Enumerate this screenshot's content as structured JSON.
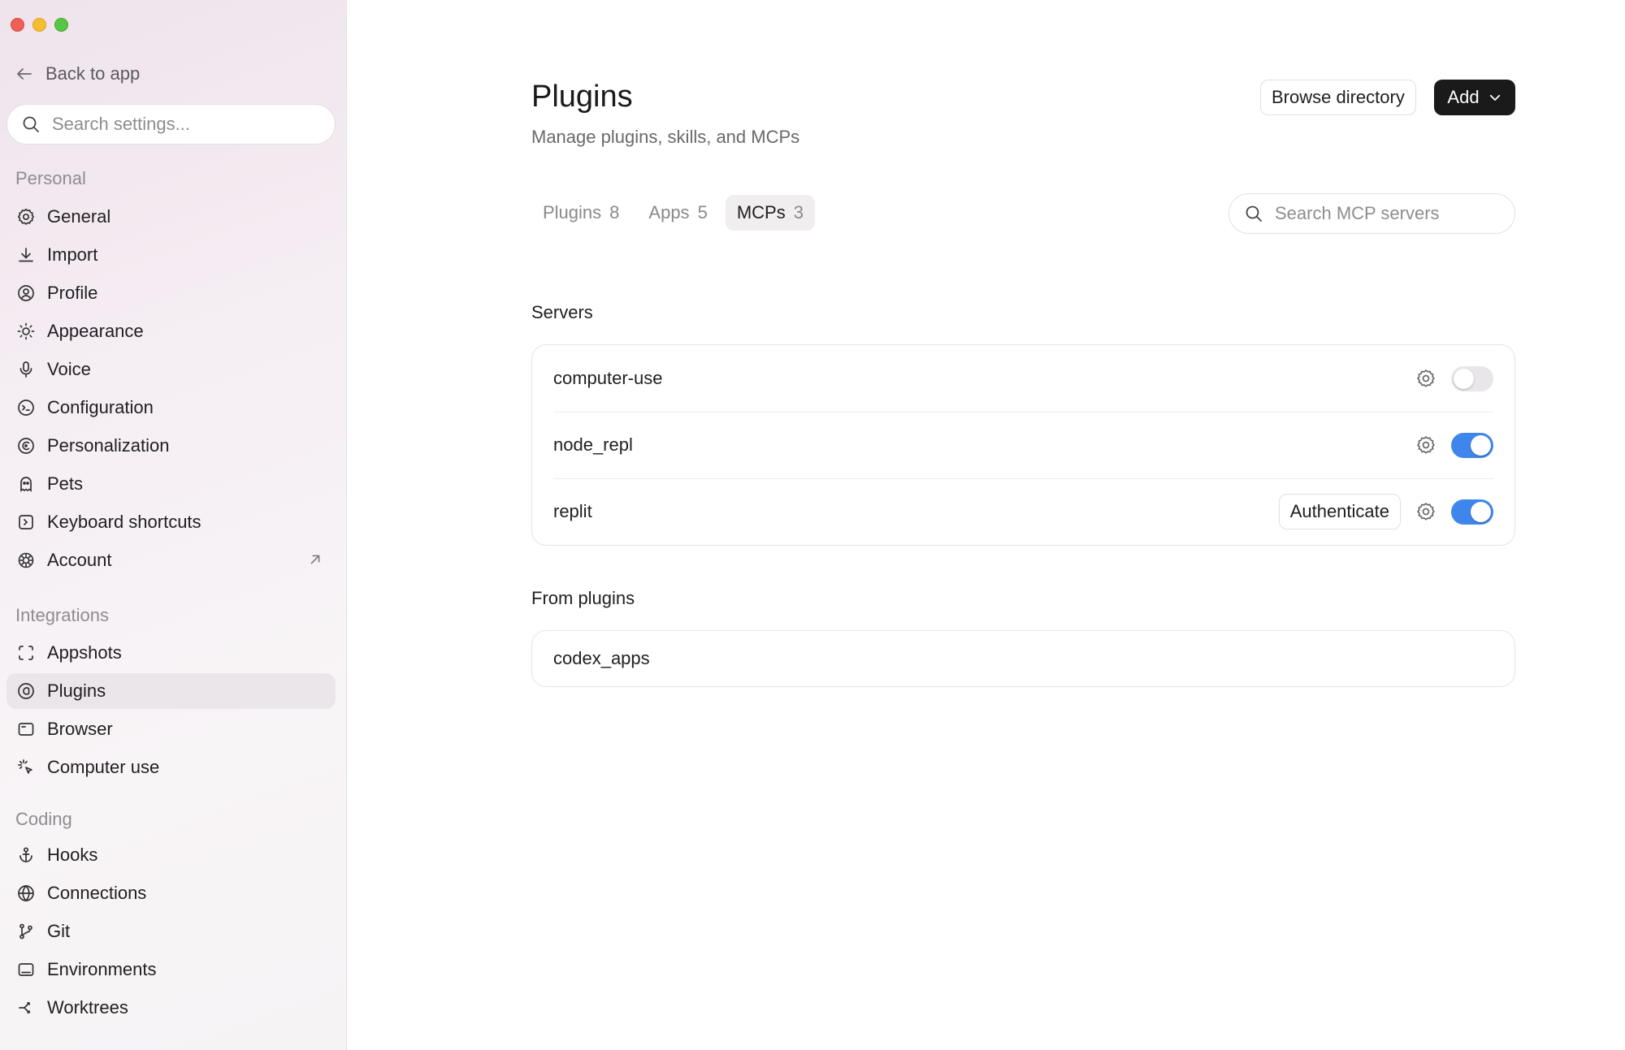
{
  "sidebar": {
    "back_label": "Back to app",
    "search_placeholder": "Search settings...",
    "sections": {
      "personal": "Personal",
      "integrations": "Integrations",
      "coding": "Coding"
    },
    "items": {
      "general": "General",
      "import": "Import",
      "profile": "Profile",
      "appearance": "Appearance",
      "voice": "Voice",
      "configuration": "Configuration",
      "personalization": "Personalization",
      "pets": "Pets",
      "keyboard_shortcuts": "Keyboard shortcuts",
      "account": "Account",
      "appshots": "Appshots",
      "plugins": "Plugins",
      "browser": "Browser",
      "computer_use": "Computer use",
      "hooks": "Hooks",
      "connections": "Connections",
      "git": "Git",
      "environments": "Environments",
      "worktrees": "Worktrees"
    },
    "active_item": "plugins"
  },
  "header": {
    "title": "Plugins",
    "subtitle": "Manage plugins, skills, and MCPs",
    "browse_label": "Browse directory",
    "add_label": "Add"
  },
  "tabs": [
    {
      "label": "Plugins",
      "count": "8",
      "active": false
    },
    {
      "label": "Apps",
      "count": "5",
      "active": false
    },
    {
      "label": "MCPs",
      "count": "3",
      "active": true
    }
  ],
  "search": {
    "placeholder": "Search MCP servers"
  },
  "servers": {
    "title": "Servers",
    "rows": [
      {
        "name": "computer-use",
        "enabled": false
      },
      {
        "name": "node_repl",
        "enabled": true
      },
      {
        "name": "replit",
        "enabled": true,
        "action_label": "Authenticate"
      }
    ]
  },
  "from_plugins": {
    "title": "From plugins",
    "rows": [
      {
        "name": "codex_apps"
      }
    ]
  },
  "colors": {
    "accent": "#3f86ec",
    "primary_button": "#1a1a1a",
    "active_nav": "#ebe6ea"
  }
}
